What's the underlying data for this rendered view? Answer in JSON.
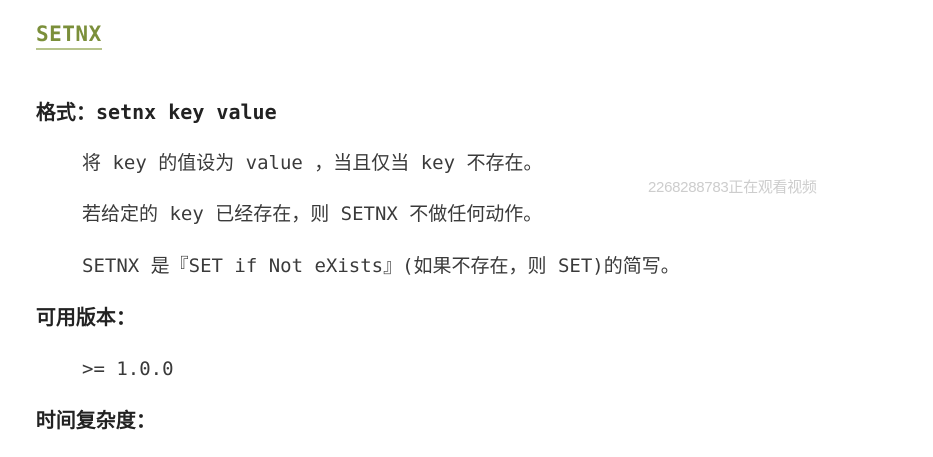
{
  "document": {
    "title": "SETNX",
    "format_heading": "格式：setnx key value",
    "description_lines": [
      "将 key 的值设为 value ，当且仅当 key 不存在。",
      "若给定的 key 已经存在，则 SETNX 不做任何动作。",
      "SETNX 是『SET if Not eXists』(如果不存在，则 SET)的简写。"
    ],
    "version_heading": "可用版本：",
    "version_value": ">= 1.0.0",
    "complexity_heading": "时间复杂度："
  },
  "watermark": {
    "text": "2268288783正在观看视频"
  },
  "colors": {
    "title": "#7b8f3a",
    "title_underline": "#b7c48c",
    "text": "#222222",
    "body_text": "#3a3a3a",
    "watermark": "#c8c8c8"
  }
}
